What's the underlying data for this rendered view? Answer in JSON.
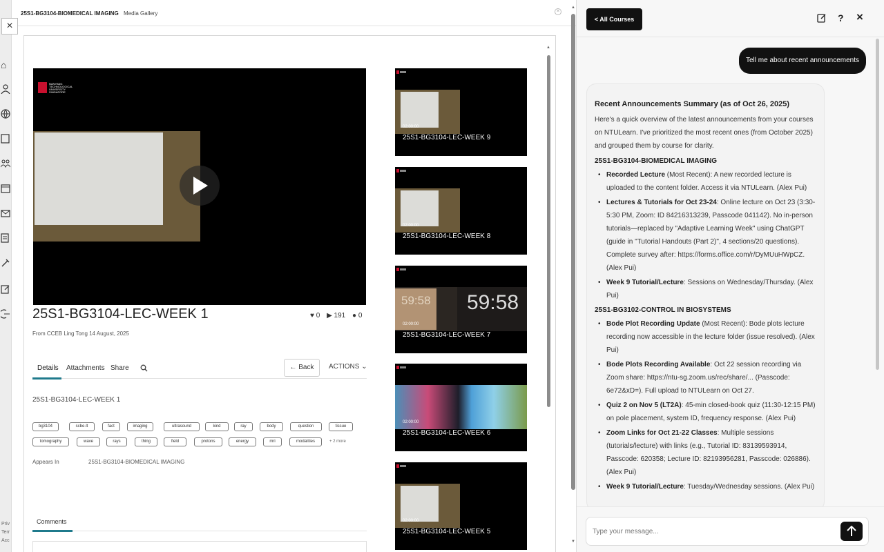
{
  "media_panel": {
    "course_title": "25S1-BG3104-BIOMEDICAL IMAGING",
    "gallery_label": "Media Gallery",
    "video": {
      "logo_text": "NANYANG TECHNOLOGICAL UNIVERSITY SINGAPORE",
      "title": "25S1-BG3104-LEC-WEEK 1",
      "likes": "0",
      "plays": "191",
      "comments": "0",
      "from": "From CCEB Ling Tong 14 August, 2025"
    },
    "tabs": [
      "Details",
      "Attachments",
      "Share"
    ],
    "back_label": "Back",
    "actions_label": "ACTIONS",
    "detail_title": "25S1-BG3104-LEC-WEEK 1",
    "tags": [
      "bg3104",
      "scbe-lt",
      "fact",
      "imaging",
      "ultrasound",
      "kind",
      "ray",
      "body",
      "question",
      "tissue",
      "tomography",
      "wave",
      "rays",
      "thing",
      "field",
      "protons",
      "energy",
      "mri",
      "modalities"
    ],
    "more_tags": "+ 2 more",
    "appears_in_label": "Appears In",
    "appears_in_value": "25S1-BG3104-BIOMEDICAL IMAGING",
    "comments_label": "Comments",
    "related": [
      {
        "duration": "02:00:00",
        "name": "25S1-BG3104-LEC-WEEK 9"
      },
      {
        "duration": "02:00:00",
        "name": "25S1-BG3104-LEC-WEEK 8"
      },
      {
        "duration": "02:00:00",
        "name": "25S1-BG3104-LEC-WEEK 7",
        "clock_text": "59:58"
      },
      {
        "duration": "02:00:00",
        "name": "25S1-BG3104-LEC-WEEK 6"
      },
      {
        "duration": "02:00:00",
        "name": "25S1-BG3104-LEC-WEEK 5"
      }
    ]
  },
  "left_footer": [
    "Priv",
    "Terr",
    "Acc"
  ],
  "chat": {
    "back_label": "< All Courses",
    "header_icons": [
      "edit-icon",
      "help-icon",
      "close-icon"
    ],
    "help_glyph": "?",
    "close_glyph": "×",
    "user_message": "Tell me about recent announcements",
    "response": {
      "heading": "Recent Announcements Summary (as of Oct 26, 2025)",
      "intro": "Here's a quick overview of the latest announcements from your courses on NTULearn. I've prioritized the most recent ones (from October 2025) and grouped them by course for clarity.",
      "section1": {
        "title": "25S1-BG3104-BIOMEDICAL IMAGING",
        "items": [
          {
            "bold": "Recorded Lecture",
            "text": " (Most Recent): A new recorded lecture is uploaded to the content folder. Access it via NTULearn. (Alex Pui)"
          },
          {
            "bold": "Lectures & Tutorials for Oct 23-24",
            "text": ": Online lecture on Oct 23 (3:30-5:30 PM, Zoom: ID 84216313239, Passcode 041142). No in-person tutorials—replaced by \"Adaptive Learning Week\" using ChatGPT (guide in \"Tutorial Handouts (Part 2)\", 4 sections/20 questions). Complete survey after: https://forms.office.com/r/DyMUuHWpCZ. (Alex Pui)"
          },
          {
            "bold": "Week 9 Tutorial/Lecture",
            "text": ": Sessions on Wednesday/Thursday. (Alex Pui)"
          }
        ]
      },
      "section2": {
        "title": "25S1-BG3102-CONTROL IN BIOSYSTEMS",
        "items": [
          {
            "bold": "Bode Plot Recording Update",
            "text": " (Most Recent): Bode plots lecture recording now accessible in the lecture folder (issue resolved). (Alex Pui)"
          },
          {
            "bold": "Bode Plots Recording Available",
            "text": ": Oct 22 session recording via Zoom share: https://ntu-sg.zoom.us/rec/share/... (Passcode: 6e72&xD=). Full upload to NTULearn on Oct 27."
          },
          {
            "bold": "Quiz 2 on Nov 5 (LT2A)",
            "text": ": 45-min closed-book quiz (11:30-12:15 PM) on pole placement, system ID, frequency response. (Alex Pui)"
          },
          {
            "bold": "Zoom Links for Oct 21-22 Classes",
            "text": ": Multiple sessions (tutorials/lecture) with links (e.g., Tutorial ID: 83139593914, Passcode: 620358; Lecture ID: 82193956281, Passcode: 026886). (Alex Pui)"
          },
          {
            "bold": "Week 9 Tutorial/Lecture",
            "text": ": Tuesday/Wednesday sessions. (Alex Pui)"
          }
        ]
      }
    },
    "input_placeholder": "Type your message..."
  }
}
